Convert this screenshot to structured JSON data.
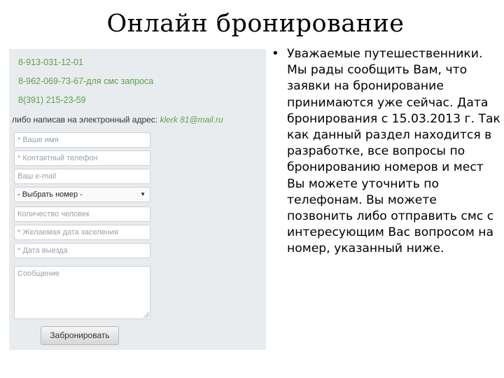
{
  "title": "Онлайн бронирование",
  "contacts": {
    "phone1": "8-913-031-12-01",
    "phone2": "8-962-069-73-67-для смс запроса",
    "phone3": "8(391) 215-23-59",
    "email_prefix": "либо написав на электронный адрес: ",
    "email": "klerk 81@mail.ru"
  },
  "form": {
    "name_placeholder": "* Ваше имя",
    "phone_placeholder": "* Контактный телефон",
    "email_placeholder": "Ваш e-mail",
    "room_select_value": "- Выбрать номер -",
    "guests_placeholder": "Количество человек",
    "checkin_placeholder": "* Желаемая дата заселения",
    "checkout_placeholder": "* Дата выезда",
    "message_placeholder": "Сообщение",
    "submit_label": "Забронировать"
  },
  "notice": {
    "bullet": "•",
    "text": "Уважаемые путешественники. Мы рады сообщить Вам, что заявки на бронирование принимаются уже сейчас. Дата бронирования с 15.03.2013 г. Так как данный раздел находится в разработке, все вопросы по бронированию номеров и мест Вы можете уточнить по телефонам.  Вы можете позвонить либо отправить смс с интересующим Вас вопросом на номер, указанный ниже."
  }
}
